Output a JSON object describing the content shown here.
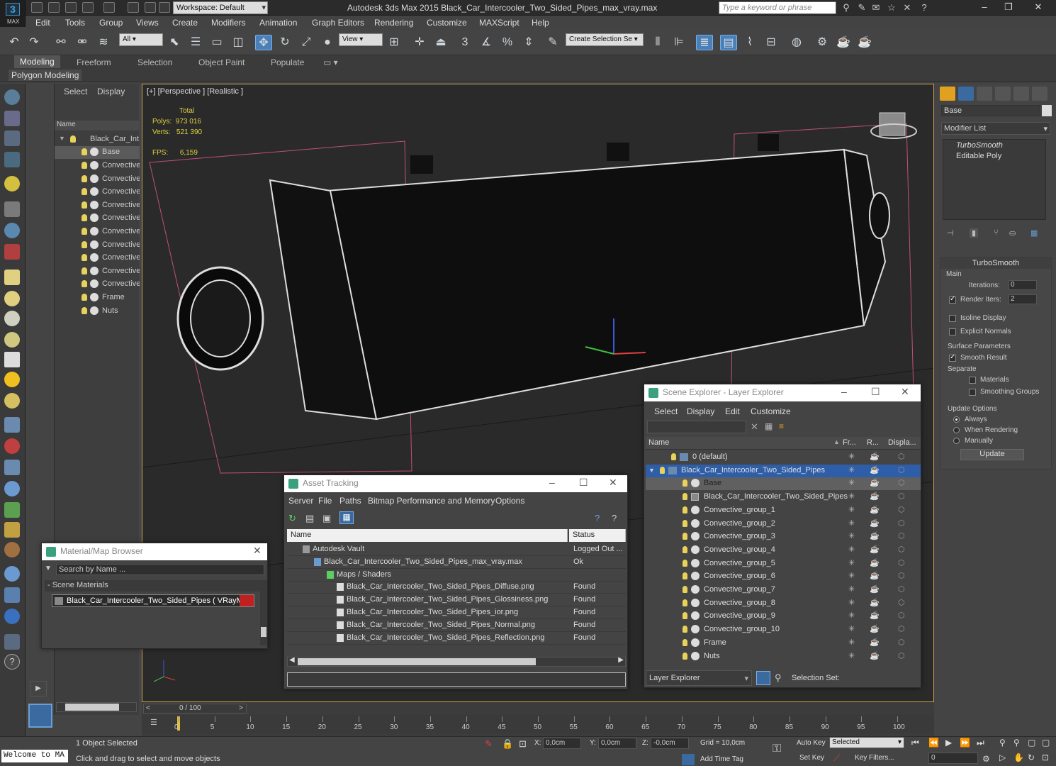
{
  "app": {
    "logo_text": "MAX",
    "workspace": "Workspace: Default",
    "title": "Autodesk 3ds Max  2015     Black_Car_Intercooler_Two_Sided_Pipes_max_vray.max",
    "search_placeholder": "Type a keyword or phrase"
  },
  "menu": [
    "Edit",
    "Tools",
    "Group",
    "Views",
    "Create",
    "Modifiers",
    "Animation",
    "Graph Editors",
    "Rendering",
    "Customize",
    "MAXScript",
    "Help"
  ],
  "toolbar": {
    "filter": "All",
    "view": "View",
    "selection_set": "Create Selection Se"
  },
  "ribbon": {
    "tabs": [
      "Modeling",
      "Freeform",
      "Selection",
      "Object Paint",
      "Populate"
    ],
    "sub": "Polygon Modeling"
  },
  "scene_explorer": {
    "tabs": [
      "Select",
      "Display"
    ],
    "column": "Name",
    "root": "Black_Car_Int...",
    "items": [
      "Base",
      "Convective",
      "Convective",
      "Convective",
      "Convective",
      "Convective",
      "Convective",
      "Convective",
      "Convective",
      "Convective",
      "Convective",
      "Frame",
      "Nuts"
    ]
  },
  "viewport": {
    "label": "[+] [Perspective ] [Realistic ]",
    "stats_header": "Total",
    "polys_label": "Polys:",
    "polys": "973 016",
    "verts_label": "Verts:",
    "verts": "521 390",
    "fps_label": "FPS:",
    "fps": "6,159"
  },
  "command_panel": {
    "object_name": "Base",
    "modifier_list": "Modifier List",
    "stack": [
      "TurboSmooth",
      "Editable Poly"
    ],
    "rollout_title": "TurboSmooth",
    "main_group": "Main",
    "iterations_label": "Iterations:",
    "iterations": "0",
    "render_iters_label": "Render Iters:",
    "render_iters": "2",
    "isoline": "Isoline Display",
    "explicit_normals": "Explicit Normals",
    "surface_group": "Surface Parameters",
    "smooth_result": "Smooth Result",
    "separate": "Separate",
    "materials": "Materials",
    "smoothing_groups": "Smoothing Groups",
    "update_group": "Update Options",
    "always": "Always",
    "when_rendering": "When Rendering",
    "manually": "Manually",
    "update_btn": "Update"
  },
  "layer_explorer": {
    "title": "Scene Explorer - Layer Explorer",
    "menu": [
      "Select",
      "Display",
      "Edit",
      "Customize"
    ],
    "columns": [
      "Name",
      "Fr...",
      "R...",
      "Displa..."
    ],
    "rows": [
      "0 (default)",
      "Black_Car_Intercooler_Two_Sided_Pipes",
      "Base",
      "Black_Car_Intercooler_Two_Sided_Pipes",
      "Convective_group_1",
      "Convective_group_2",
      "Convective_group_3",
      "Convective_group_4",
      "Convective_group_5",
      "Convective_group_6",
      "Convective_group_7",
      "Convective_group_8",
      "Convective_group_9",
      "Convective_group_10",
      "Frame",
      "Nuts"
    ],
    "footer_mode": "Layer Explorer",
    "selection_set": "Selection Set:"
  },
  "asset_tracking": {
    "title": "Asset Tracking",
    "menu": [
      "Server",
      "File",
      "Paths",
      "Bitmap Performance and Memory",
      "Options"
    ],
    "columns": [
      "Name",
      "Status"
    ],
    "rows": [
      {
        "name": "Autodesk Vault",
        "status": "Logged Out ..."
      },
      {
        "name": "Black_Car_Intercooler_Two_Sided_Pipes_max_vray.max",
        "status": "Ok"
      },
      {
        "name": "Maps / Shaders",
        "status": ""
      },
      {
        "name": "Black_Car_Intercooler_Two_Sided_Pipes_Diffuse.png",
        "status": "Found"
      },
      {
        "name": "Black_Car_Intercooler_Two_Sided_Pipes_Glossiness.png",
        "status": "Found"
      },
      {
        "name": "Black_Car_Intercooler_Two_Sided_Pipes_ior.png",
        "status": "Found"
      },
      {
        "name": "Black_Car_Intercooler_Two_Sided_Pipes_Normal.png",
        "status": "Found"
      },
      {
        "name": "Black_Car_Intercooler_Two_Sided_Pipes_Reflection.png",
        "status": "Found"
      }
    ]
  },
  "material_browser": {
    "title": "Material/Map Browser",
    "search": "Search by Name ...",
    "group": "- Scene Materials",
    "item": "Black_Car_Intercooler_Two_Sided_Pipes ( VRayMtl ) ..."
  },
  "timeline": {
    "frame": "0 / 100",
    "ticks": [
      "0",
      "5",
      "10",
      "15",
      "20",
      "25",
      "30",
      "35",
      "40",
      "45",
      "50",
      "55",
      "60",
      "65",
      "70",
      "75",
      "80",
      "85",
      "90",
      "95",
      "100"
    ]
  },
  "status": {
    "listener": "Welcome to MA",
    "selected": "1 Object Selected",
    "prompt": "Click and drag to select and move objects",
    "x_label": "X:",
    "x": "0,0cm",
    "y_label": "Y:",
    "y": "0,0cm",
    "z_label": "Z:",
    "z": "-0,0cm",
    "grid": "Grid = 10,0cm",
    "add_time_tag": "Add Time Tag",
    "auto_key": "Auto Key",
    "auto_key_mode": "Selected",
    "set_key": "Set Key",
    "key_filters": "Key Filters...",
    "frame": "0"
  }
}
